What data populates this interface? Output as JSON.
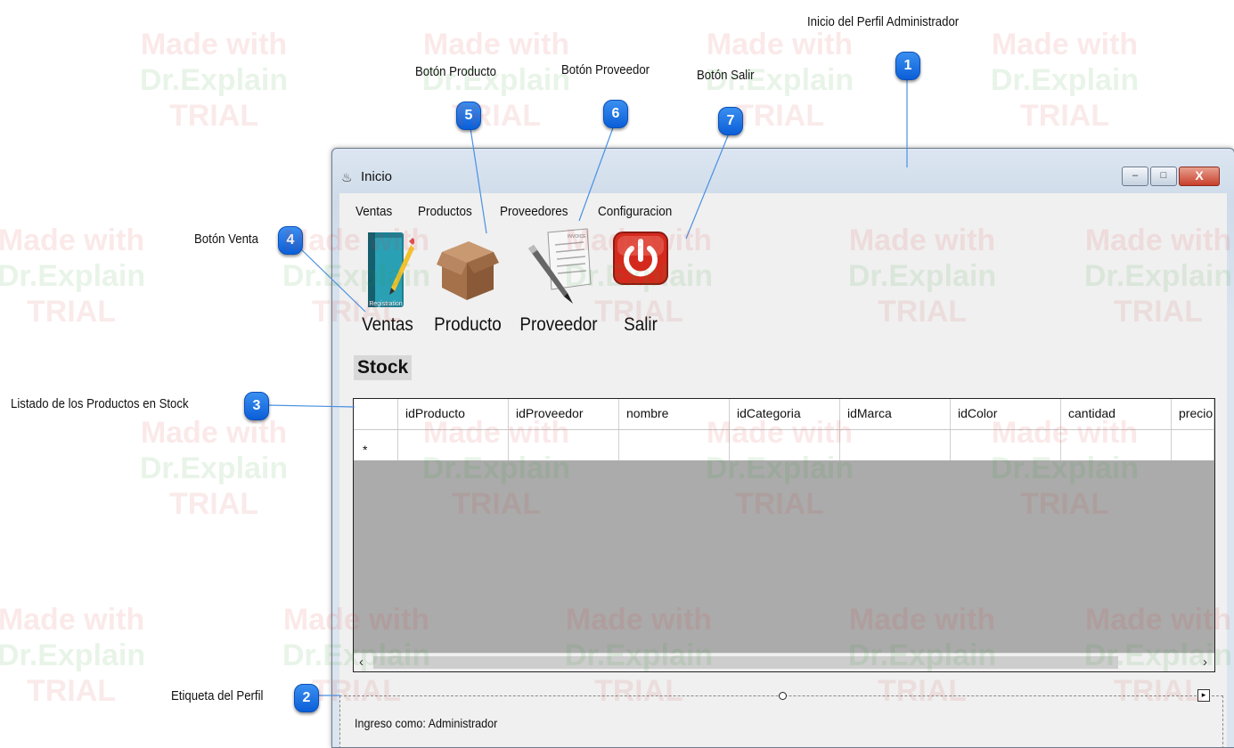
{
  "window": {
    "title": "Inicio",
    "controls": {
      "minimize": "–",
      "maximize": "□",
      "close": "X"
    }
  },
  "menu": [
    "Ventas",
    "Productos",
    "Proveedores",
    "Configuracion"
  ],
  "toolbar": {
    "buttons": [
      {
        "label": "Ventas",
        "icon": "registration-book-icon",
        "icon_text": "Registration"
      },
      {
        "label": "Producto",
        "icon": "box-icon"
      },
      {
        "label": "Proveedor",
        "icon": "invoice-icon",
        "icon_text": "INVOICE"
      },
      {
        "label": "Salir",
        "icon": "power-icon"
      }
    ]
  },
  "stock_label": "Stock",
  "grid": {
    "columns": [
      "idProducto",
      "idProveedor",
      "nombre",
      "idCategoria",
      "idMarca",
      "idColor",
      "cantidad",
      "precio"
    ],
    "new_row_marker": "*",
    "scroll_left": "‹",
    "scroll_right": "›"
  },
  "status": "Ingreso como: Administrador",
  "callouts": [
    {
      "num": "1",
      "label": "Inicio del Perfil Administrador"
    },
    {
      "num": "2",
      "label": "Etiqueta del Perfil"
    },
    {
      "num": "3",
      "label": "Listado de los Productos en Stock"
    },
    {
      "num": "4",
      "label": "Botón Venta"
    },
    {
      "num": "5",
      "label": "Botón Producto"
    },
    {
      "num": "6",
      "label": "Botón Proveedor"
    },
    {
      "num": "7",
      "label": "Botón Salir"
    }
  ],
  "watermark": {
    "line1": "Made with",
    "line2": "Dr.Explain",
    "line3": "TRIAL"
  },
  "colors": {
    "badge": "#1a6fe6",
    "close_button": "#c8402c",
    "power_red": "#d42a1e",
    "grid_empty": "#ababab"
  }
}
